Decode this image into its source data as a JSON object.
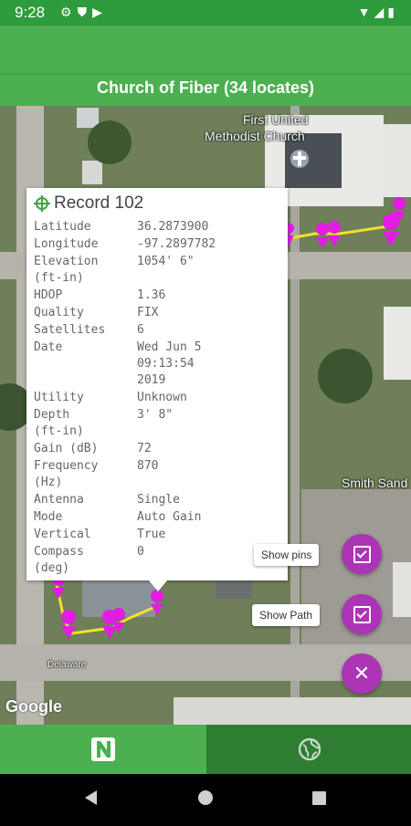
{
  "status_bar": {
    "time": "9:28",
    "left_icons": [
      "gear-icon",
      "shield-icon",
      "play-store-icon"
    ],
    "right_icons": [
      "wifi-icon",
      "signal-icon",
      "battery-icon"
    ]
  },
  "header": {
    "title": "Church of Fiber (34 locates)"
  },
  "map": {
    "labels": {
      "church_line1": "First United",
      "church_line2": "Methodist Church",
      "smith_sand": "Smith Sand",
      "delaware": "Delaware"
    },
    "attribution": "Google"
  },
  "record": {
    "title": "Record 102",
    "rows": [
      {
        "key": "Latitude",
        "value": "36.2873900"
      },
      {
        "key": "Longitude",
        "value": "-97.2897782"
      },
      {
        "key": "Elevation\n(ft-in)",
        "value": "1054' 6\""
      },
      {
        "key": "HDOP",
        "value": "1.36"
      },
      {
        "key": "Quality",
        "value": "FIX"
      },
      {
        "key": "Satellites",
        "value": "6"
      },
      {
        "key": "Date",
        "value": "Wed Jun  5\n09:13:54\n2019"
      },
      {
        "key": "Utility",
        "value": "Unknown"
      },
      {
        "key": "Depth\n(ft-in)",
        "value": "3' 8\""
      },
      {
        "key": "Gain (dB)",
        "value": "72"
      },
      {
        "key": "Frequency\n(Hz)",
        "value": "870"
      },
      {
        "key": "Antenna",
        "value": "Single"
      },
      {
        "key": "Mode",
        "value": "Auto Gain"
      },
      {
        "key": "Vertical",
        "value": "True"
      },
      {
        "key": "Compass\n(deg)",
        "value": "0"
      }
    ]
  },
  "controls": {
    "show_pins_label": "Show pins",
    "show_path_label": "Show Path",
    "close_glyph": "✕",
    "accent": "#ab35b5"
  },
  "bottom_nav": {
    "left_icon": "app-logo-icon",
    "right_icon": "globe-icon"
  },
  "colors": {
    "status_bar": "#2e9b3c",
    "app_bar": "#4caf50",
    "pin": "#e21ce2",
    "path": "#f2e227"
  }
}
